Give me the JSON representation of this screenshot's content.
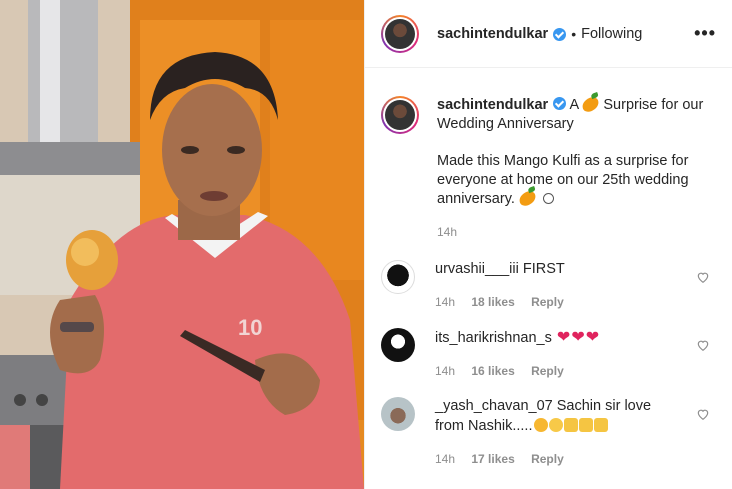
{
  "post": {
    "username": "sachintendulkar",
    "follow_status": "Following",
    "more_label": "•••"
  },
  "caption": {
    "username": "sachintendulkar",
    "line1_a": "A",
    "line1_b": "Surprise for our Wedding Anniversary",
    "body": "Made this Mango Kulfi as a surprise for everyone at home on our 25th wedding anniversary.",
    "time": "14h"
  },
  "comments": [
    {
      "username": "urvashii___iii",
      "text": "FIRST",
      "time": "14h",
      "likes": "18 likes",
      "reply": "Reply"
    },
    {
      "username": "its_harikrishnan_s",
      "text": "",
      "time": "14h",
      "likes": "16 likes",
      "reply": "Reply"
    },
    {
      "username": "_yash_chavan_07",
      "text": "Sachin sir love from Nashik.....",
      "time": "14h",
      "likes": "17 likes",
      "reply": "Reply"
    }
  ],
  "colors": {
    "verified": "#3897f0",
    "heart": "#e0245e",
    "meta": "#8e8e8e"
  }
}
